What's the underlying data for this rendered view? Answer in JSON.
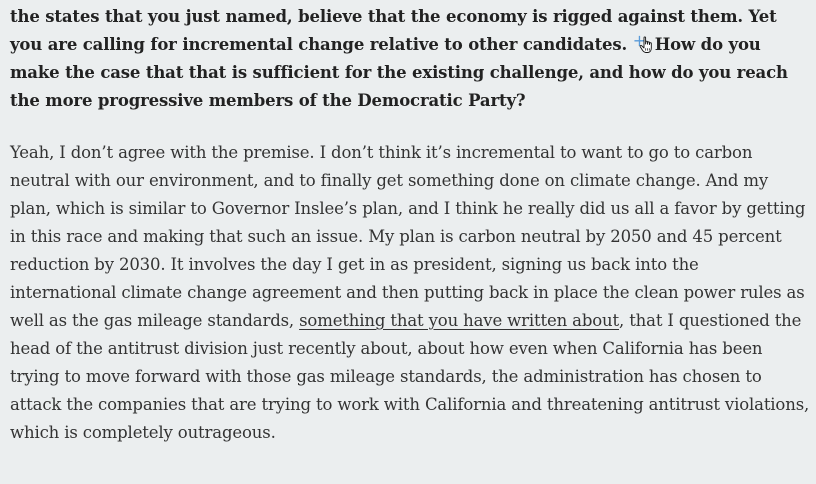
{
  "question": {
    "text_before_marker": "the states that you just named, believe that the economy is rigged against them. Yet you are calling for incremental change relative to other candidates. ",
    "text_after_marker": "How do you make the case that that is sufficient for the existing challenge, and how do you reach the more progressive members of the Democratic Party?"
  },
  "marker": {
    "plus_glyph": "+"
  },
  "answer": {
    "text_before_link": "Yeah, I don’t agree with the premise. I don’t think it’s incremental to want to go to carbon neutral with our environment, and to finally get something done on climate change. And my plan, which is similar to Governor Inslee’s plan, and I think he really did us all a favor by getting in this race and making that such an issue. My plan is carbon neutral by 2050 and 45 percent reduction by 2030. It involves the day I get in as president, signing us back into the international climate change agreement and then putting back in place the clean power rules as well as the gas mileage standards, ",
    "link_text": "something that you have written about",
    "text_after_link": ", that I questioned the head of the antitrust division just recently about, about how even when California has been trying to move forward with those gas mileage standards, the administration has chosen to attack the companies that are trying to work with California and threatening antitrust violations, which is completely outrageous."
  },
  "colors": {
    "background": "#ebeeef",
    "text": "#222222",
    "marker": "#5a9bd8"
  }
}
